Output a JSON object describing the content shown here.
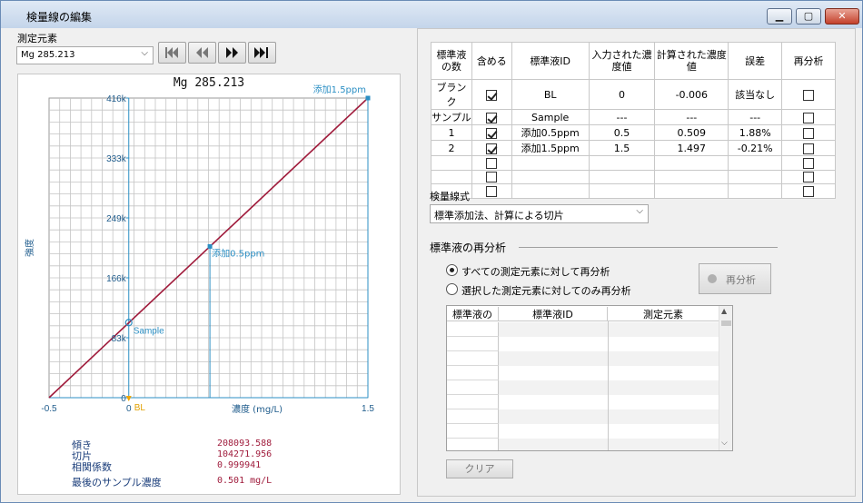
{
  "window": {
    "title": "検量線の編集"
  },
  "element_label": "測定元素",
  "element_select": {
    "value": "Mg 285.213"
  },
  "chart_data": {
    "type": "line",
    "title": "Mg 285.213",
    "xlabel": "濃度 (mg/L)",
    "ylabel": "強度",
    "xlim": [
      -0.5,
      1.5
    ],
    "ylim": [
      0,
      416000
    ],
    "x_ticks": [
      "-0.5",
      "0",
      "1.5"
    ],
    "y_ticks": [
      "0",
      "83k",
      "166k",
      "249k",
      "333k",
      "416k"
    ],
    "x": [
      -0.5,
      1.5
    ],
    "y": [
      0,
      416000
    ],
    "points": [
      {
        "label": "Sample",
        "x": 0.0,
        "y": 104272
      },
      {
        "label": "添加0.5ppm",
        "x": 0.509,
        "y": 210000
      },
      {
        "label": "添加1.5ppm",
        "x": 1.5,
        "y": 416000
      }
    ],
    "marker_label": "BL",
    "line_color": "#a01c3c",
    "grid": true
  },
  "stats": [
    {
      "label": "傾き",
      "value": "208093.588"
    },
    {
      "label": "切片",
      "value": "104271.956"
    },
    {
      "label": "相関係数",
      "value": "0.999941"
    },
    {
      "label": "最後のサンプル濃度",
      "value": "0.501 mg/L"
    }
  ],
  "std_table": {
    "headers": [
      "標準液の数",
      "含める",
      "標準液ID",
      "入力された濃度値",
      "計算された濃度値",
      "誤差",
      "再分析"
    ],
    "rows": [
      {
        "num": "ブランク",
        "include": true,
        "id": "BL",
        "input": "0",
        "calc": "-0.006",
        "error": "該当なし",
        "reanalyze": false
      },
      {
        "num": "サンプル",
        "include": true,
        "id": "Sample",
        "input": "---",
        "calc": "---",
        "error": "---",
        "reanalyze": false
      },
      {
        "num": "1",
        "include": true,
        "id": "添加0.5ppm",
        "input": "0.5",
        "calc": "0.509",
        "error": "1.88%",
        "reanalyze": false
      },
      {
        "num": "2",
        "include": true,
        "id": "添加1.5ppm",
        "input": "1.5",
        "calc": "1.497",
        "error": "-0.21%",
        "reanalyze": false
      },
      {
        "num": "",
        "include": false,
        "id": "",
        "input": "",
        "calc": "",
        "error": "",
        "reanalyze": false
      },
      {
        "num": "",
        "include": false,
        "id": "",
        "input": "",
        "calc": "",
        "error": "",
        "reanalyze": false
      },
      {
        "num": "",
        "include": false,
        "id": "",
        "input": "",
        "calc": "",
        "error": "",
        "reanalyze": false
      }
    ]
  },
  "method_label": "検量線式",
  "method_select": {
    "value": "標準添加法、計算による切片"
  },
  "reanalysis": {
    "group_label": "標準液の再分析",
    "option_all": "すべての測定元素に対して再分析",
    "option_selected": "選択した測定元素に対してのみ再分析",
    "button": "再分析",
    "list_headers": [
      "標準液の",
      "標準液ID",
      "測定元素"
    ],
    "clear_button": "クリア"
  }
}
